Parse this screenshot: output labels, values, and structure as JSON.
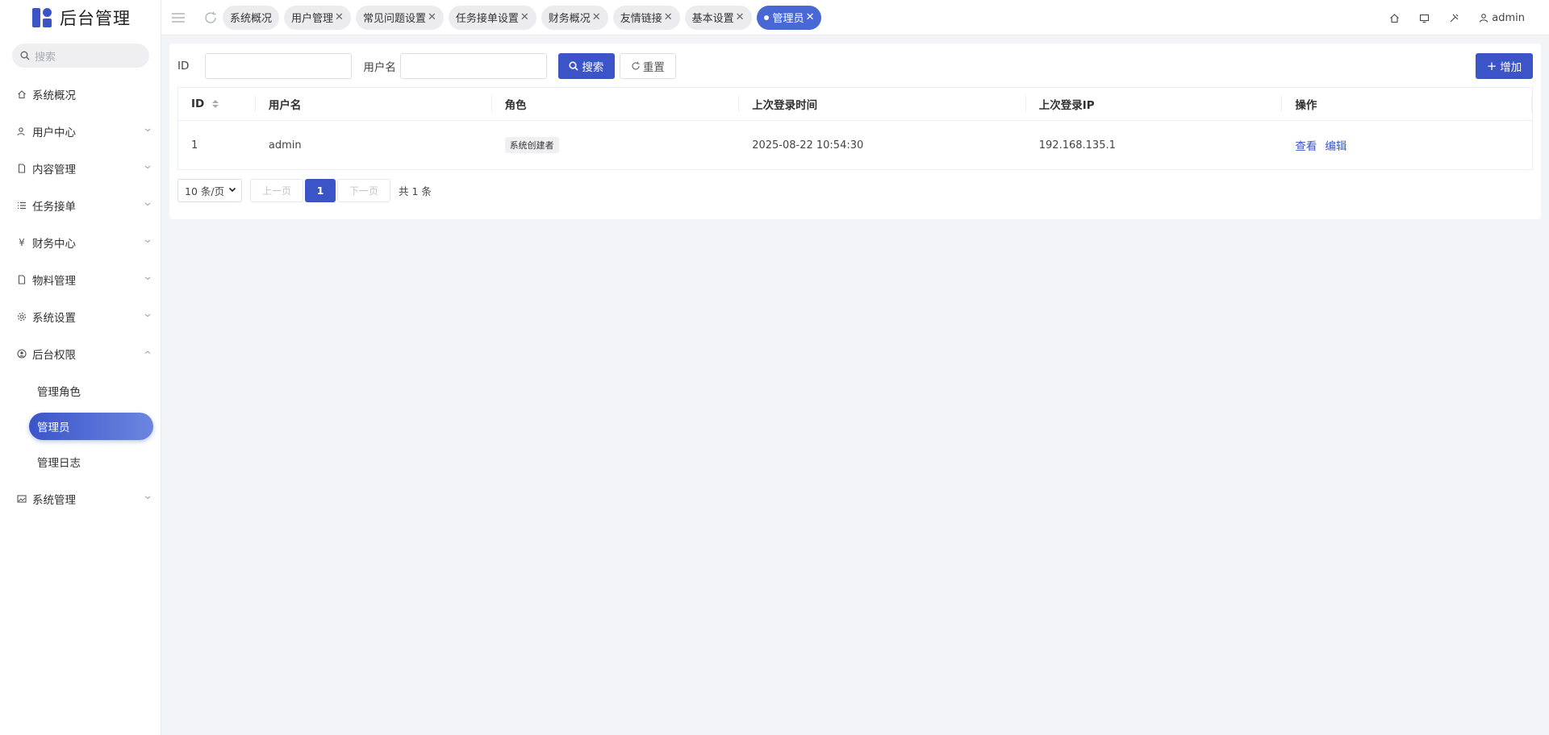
{
  "app": {
    "title": "后台管理"
  },
  "sidebar": {
    "search_placeholder": "搜索",
    "items": [
      {
        "label": "系统概况",
        "icon": "home-icon"
      },
      {
        "label": "用户中心",
        "icon": "users-icon"
      },
      {
        "label": "内容管理",
        "icon": "document-icon"
      },
      {
        "label": "任务接单",
        "icon": "list-icon"
      },
      {
        "label": "财务中心",
        "icon": "yen-icon"
      },
      {
        "label": "物料管理",
        "icon": "document-icon"
      },
      {
        "label": "系统设置",
        "icon": "gear-icon"
      },
      {
        "label": "后台权限",
        "icon": "user-circle-icon"
      },
      {
        "label": "系统管理",
        "icon": "image-icon"
      }
    ],
    "submenu": [
      "管理角色",
      "管理员",
      "管理日志"
    ]
  },
  "topbar": {
    "tabs": [
      {
        "label": "系统概况"
      },
      {
        "label": "用户管理"
      },
      {
        "label": "常见问题设置"
      },
      {
        "label": "任务接单设置"
      },
      {
        "label": "财务概况"
      },
      {
        "label": "友情链接"
      },
      {
        "label": "基本设置"
      },
      {
        "label": "管理员"
      }
    ],
    "user": "admin"
  },
  "filter": {
    "id_label": "ID",
    "username_label": "用户名",
    "search_label": "搜索",
    "reset_label": "重置",
    "add_label": "增加"
  },
  "table": {
    "headers": [
      "ID",
      "用户名",
      "角色",
      "上次登录时间",
      "上次登录IP",
      "操作"
    ],
    "rows": [
      {
        "id": "1",
        "username": "admin",
        "role": "系统创建者",
        "last_login": "2025-08-22 10:54:30",
        "ip": "192.168.135.1",
        "view": "查看",
        "edit": "编辑"
      }
    ]
  },
  "pager": {
    "page_size": "10 条/页",
    "prev": "上一页",
    "current": "1",
    "next": "下一页",
    "total": "共 1 条"
  },
  "colors": {
    "primary": "#3b55c9",
    "background": "#f3f4f7"
  }
}
